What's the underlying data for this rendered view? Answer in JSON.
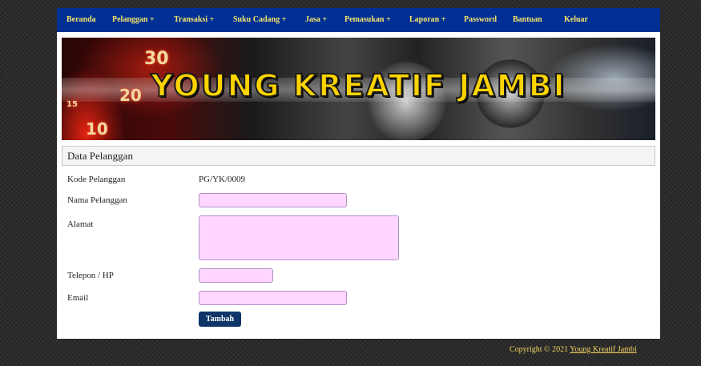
{
  "nav": {
    "items": [
      "Beranda",
      "Pelanggan  +",
      "Transaksi  +",
      "Suku Cadang  +",
      "Jasa  +",
      "Pemasukan  +",
      "Laporan  +",
      "Password",
      "Bantuan",
      "Keluar"
    ]
  },
  "banner": {
    "title": "YOUNG KREATIF JAMBI",
    "gauge_numbers": [
      "30",
      "20",
      "10",
      "15"
    ]
  },
  "section": {
    "title": "Data Pelanggan"
  },
  "form": {
    "kode_label": "Kode Pelanggan",
    "kode_value": "PG/YK/0009",
    "nama_label": "Nama Pelanggan",
    "nama_value": "",
    "alamat_label": "Alamat",
    "alamat_value": "",
    "telepon_label": "Telepon / HP",
    "telepon_value": "",
    "email_label": "Email",
    "email_value": "",
    "submit_label": "Tambah"
  },
  "footer": {
    "prefix": "Copyright © 2021 ",
    "link": "Young Kreatif Jambi"
  },
  "colors": {
    "nav_bg": "#002f95",
    "nav_text": "#f5e66a",
    "field_bg": "#ffd6ff",
    "button_bg": "#0f3468",
    "banner_title": "#ffd400"
  }
}
